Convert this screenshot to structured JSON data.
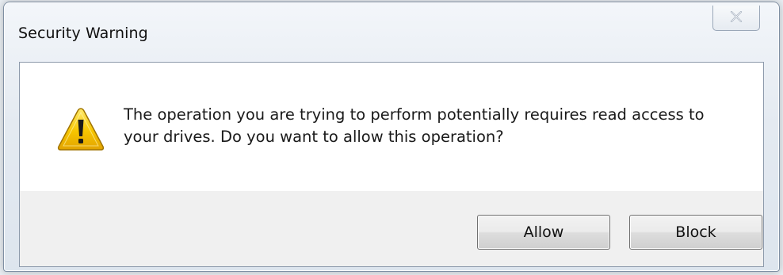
{
  "dialog": {
    "title": "Security Warning",
    "icon": "warning-icon",
    "message": "The operation you are trying to perform potentially requires read access to your drives. Do you want to allow this operation?",
    "buttons": {
      "allow": "Allow",
      "block": "Block"
    },
    "colors": {
      "warning_fill": "#f5c400",
      "warning_border": "#b58a00",
      "footer_bg": "#f0f0f0"
    }
  }
}
